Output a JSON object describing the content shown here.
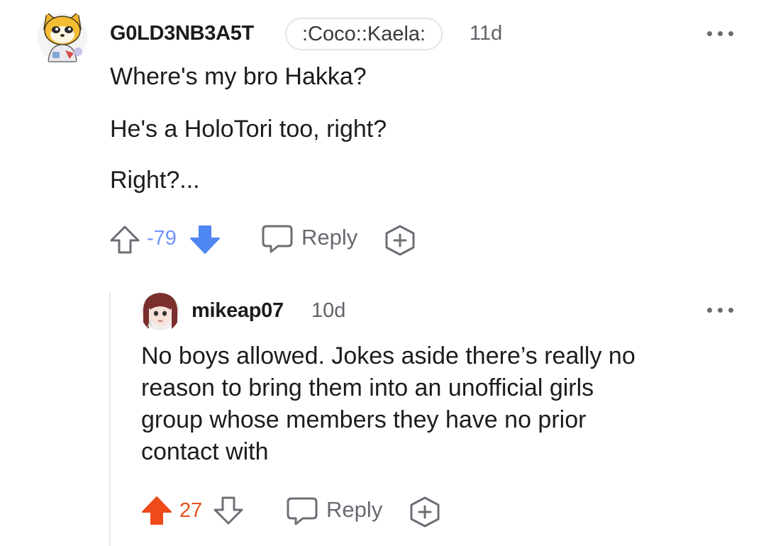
{
  "comments": [
    {
      "username": "G0LD3NB3A5T",
      "flair": ":Coco::Kaela:",
      "age": "11d",
      "body": [
        "Where's my bro Hakka?",
        "He's a HoloTori too, right?",
        "Right?..."
      ],
      "score": "-79",
      "vote_state": "downvoted",
      "reply_label": "Reply",
      "colors": {
        "score": "#7193ff",
        "downvote": "#4e86f2"
      },
      "avatar": "shiba-dog-avatar"
    },
    {
      "username": "mikeap07",
      "age": "10d",
      "body": [
        "No boys allowed. Jokes aside there’s really no",
        "reason to bring them into an unofficial girls",
        "group whose members they have no prior",
        "contact with"
      ],
      "score": "27",
      "vote_state": "upvoted",
      "reply_label": "Reply",
      "colors": {
        "score": "#e0501f",
        "upvote": "#ee4a1a"
      },
      "avatar": "anime-girl-avatar"
    }
  ],
  "icons": {
    "more": "more-options-icon",
    "upvote": "upvote-arrow-icon",
    "downvote": "downvote-arrow-icon",
    "reply": "reply-bubble-icon",
    "award": "award-plus-icon"
  }
}
